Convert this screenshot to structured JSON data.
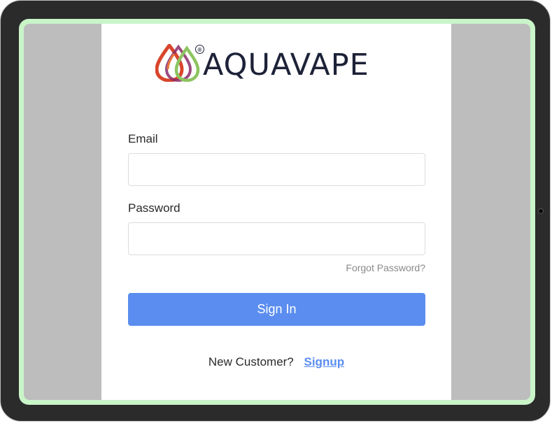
{
  "brand": {
    "name": "AQUAVAPE",
    "registered_mark": "®",
    "colors": {
      "drop_red": "#d9452c",
      "drop_orange": "#e9783a",
      "drop_purple": "#8a2c6a",
      "drop_green": "#8cc460",
      "text": "#1d2238"
    }
  },
  "form": {
    "email_label": "Email",
    "email_value": "",
    "email_placeholder": "",
    "password_label": "Password",
    "password_value": "",
    "password_placeholder": "",
    "forgot_label": "Forgot Password?",
    "signin_label": "Sign In"
  },
  "footer": {
    "prompt": "New Customer?",
    "signup_label": "Signup"
  },
  "theme": {
    "accent": "#5a8def",
    "frame_border": "#c9f5c9",
    "background_side": "#bdbdbd"
  }
}
